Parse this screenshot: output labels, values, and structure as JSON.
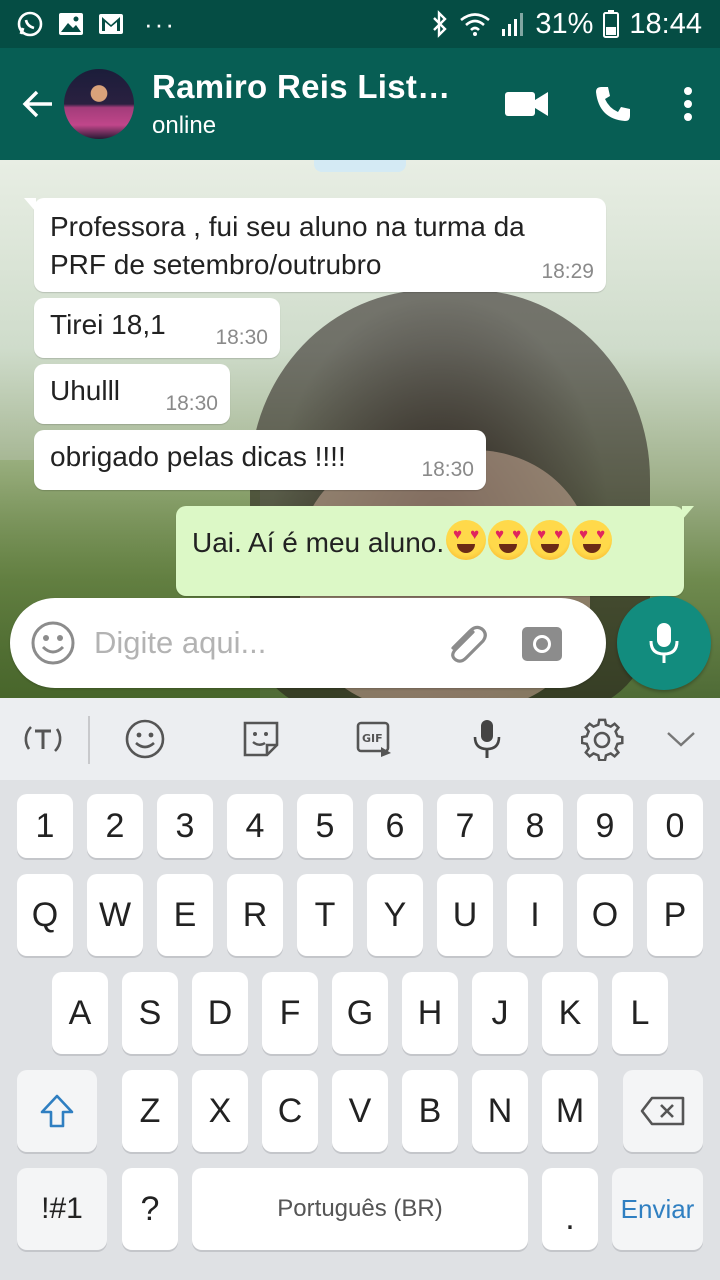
{
  "status_bar": {
    "icons_left": [
      "whatsapp-icon",
      "gallery-icon",
      "gmail-icon",
      "more-notifications-icon"
    ],
    "more_notifications": "···",
    "battery": "31%",
    "time": "18:44"
  },
  "header": {
    "contact_name": "Ramiro Reis List…",
    "contact_status": "online"
  },
  "messages": [
    {
      "direction": "in",
      "text_lines": [
        "Professora , fui seu aluno na turma da",
        "PRF de setembro/outrubro"
      ],
      "time": "18:29"
    },
    {
      "direction": "in",
      "text": "Tirei 18,1",
      "time": "18:30"
    },
    {
      "direction": "in",
      "text": "Uhulll",
      "time": "18:30"
    },
    {
      "direction": "in",
      "text": "obrigado pelas dicas !!!!",
      "time": "18:30"
    },
    {
      "direction": "out",
      "text": "Uai. Aí é meu aluno.",
      "emoji": "heart-eyes-emoji",
      "emoji_count": 4
    }
  ],
  "compose": {
    "placeholder": "Digite aqui..."
  },
  "keyboard": {
    "toolbar_icons": [
      "text-mode-icon",
      "emoji-icon",
      "sticker-icon",
      "gif-icon",
      "voice-input-icon",
      "settings-icon",
      "collapse-icon"
    ],
    "gif_label": "GIF",
    "row_numbers": [
      "1",
      "2",
      "3",
      "4",
      "5",
      "6",
      "7",
      "8",
      "9",
      "0"
    ],
    "row_top": [
      "Q",
      "W",
      "E",
      "R",
      "T",
      "Y",
      "U",
      "I",
      "O",
      "P"
    ],
    "row_middle": [
      "A",
      "S",
      "D",
      "F",
      "G",
      "H",
      "J",
      "K",
      "L"
    ],
    "row_bottom": [
      "Z",
      "X",
      "C",
      "V",
      "B",
      "N",
      "M"
    ],
    "symbols_key": "!#1",
    "question_key": "?",
    "space_key": "Português (BR)",
    "period_key": ".",
    "send_key": "Enviar",
    "send_color": "#2f7fc1"
  },
  "colors": {
    "status_bar": "#054d44",
    "app_bar": "#075e54",
    "outgoing_bubble": "#dcf8c6",
    "mic_button": "#128c7e"
  }
}
